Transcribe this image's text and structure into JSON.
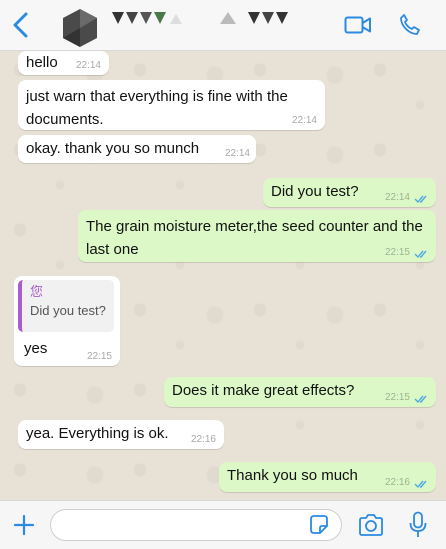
{
  "header": {
    "back_icon": "chevron-left-icon",
    "contact_avatar": "contact-avatar",
    "contact_name": "",
    "video_icon": "video-camera-icon",
    "phone_icon": "phone-icon"
  },
  "messages": [
    {
      "direction": "in",
      "text": "hello",
      "time": "22:14"
    },
    {
      "direction": "in",
      "text": "just warn that everything is fine with the documents.",
      "time": "22:14"
    },
    {
      "direction": "in",
      "text": "okay. thank you so munch",
      "time": "22:14"
    },
    {
      "direction": "out",
      "text": "Did you test?",
      "time": "22:14",
      "status": "read"
    },
    {
      "direction": "out",
      "text": "The grain moisture meter,the seed counter and the last one",
      "time": "22:15",
      "status": "read"
    },
    {
      "direction": "in",
      "text": "yes",
      "time": "22:15",
      "reply": {
        "name": "您",
        "text": "Did you test?"
      }
    },
    {
      "direction": "out",
      "text": "Does it make great effects?",
      "time": "22:15",
      "status": "read"
    },
    {
      "direction": "in",
      "text": "yea. Everything is ok.",
      "time": "22:16"
    },
    {
      "direction": "out",
      "text": "Thank you so much",
      "time": "22:16",
      "status": "read"
    }
  ],
  "input_bar": {
    "add_icon": "plus-icon",
    "message_placeholder": "",
    "sticker_icon": "sticker-icon",
    "camera_icon": "camera-icon",
    "mic_icon": "microphone-icon"
  },
  "colors": {
    "accent": "#2a8ae4",
    "incoming_bubble": "#ffffff",
    "outgoing_bubble": "#dcf8c6",
    "read_ticks": "#4fa9e4",
    "reply_accent": "#a85cd0"
  }
}
